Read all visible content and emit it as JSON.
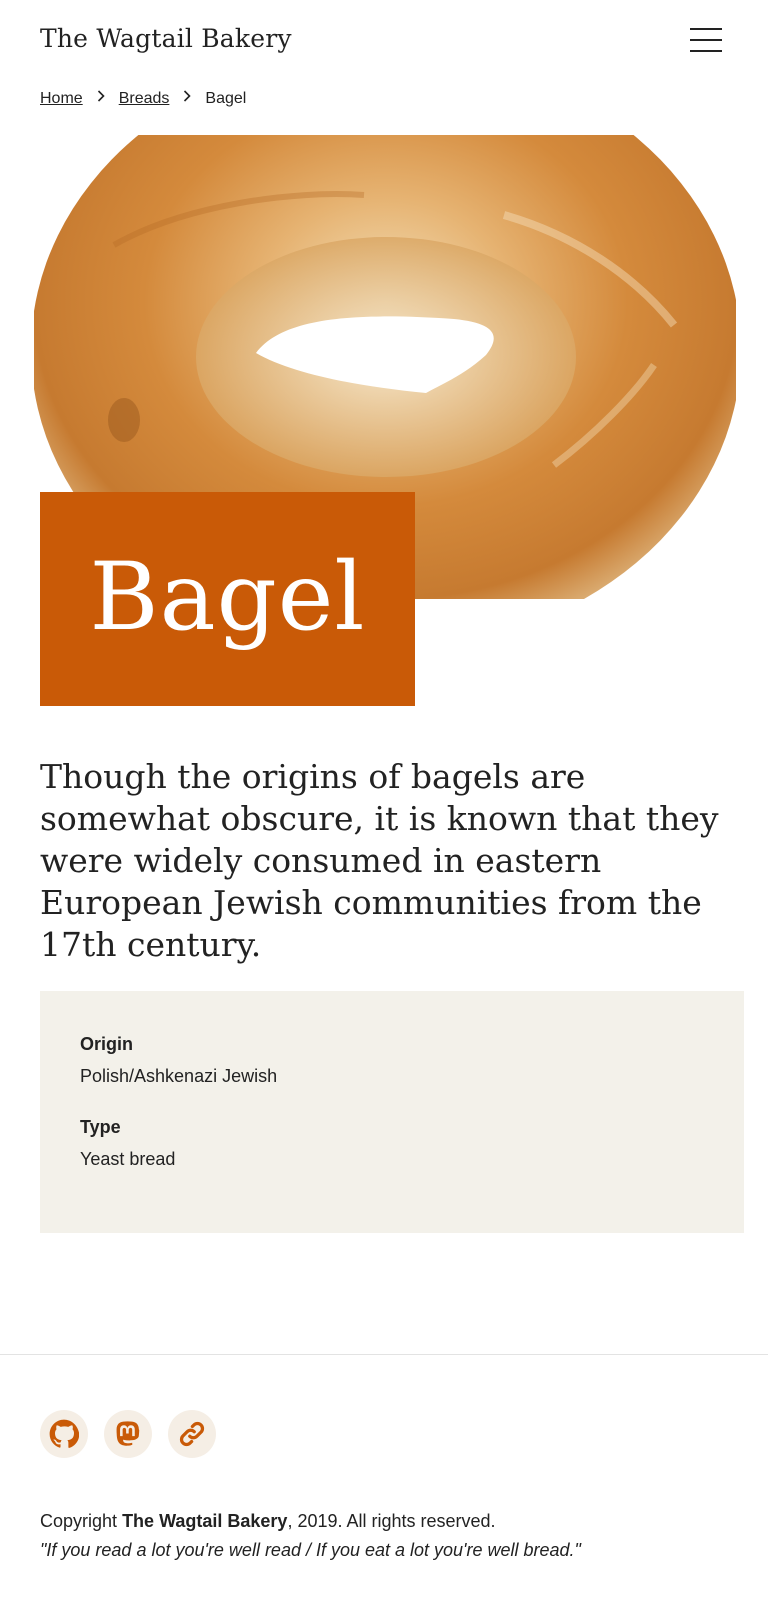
{
  "header": {
    "site_title": "The Wagtail Bakery",
    "menu_icon": "hamburger-menu-icon"
  },
  "breadcrumb": {
    "items": [
      {
        "label": "Home"
      },
      {
        "label": "Breads"
      },
      {
        "label": "Bagel"
      }
    ],
    "separator_icon": "chevron-right-icon"
  },
  "page": {
    "title": "Bagel",
    "intro": "Though the origins of bagels are somewhat obscure, it is known that they were widely consumed in eastern European Jewish communities from the 17th century."
  },
  "facts": [
    {
      "label": "Origin",
      "value": "Polish/Ashkenazi Jewish"
    },
    {
      "label": "Type",
      "value": "Yeast bread"
    }
  ],
  "footer": {
    "social_icons": [
      "github-icon",
      "mastodon-icon",
      "link-icon"
    ],
    "copyright_prefix": "Copyright",
    "copyright_brand": "The Wagtail Bakery",
    "copyright_suffix": ", 2019. All rights reserved.",
    "quote": "\"If you read a lot you're well read / If you eat a lot you're well bread.\""
  },
  "colors": {
    "accent": "#c95a07",
    "facts_bg": "#f3f1ea",
    "social_bg": "#f5eee5"
  }
}
